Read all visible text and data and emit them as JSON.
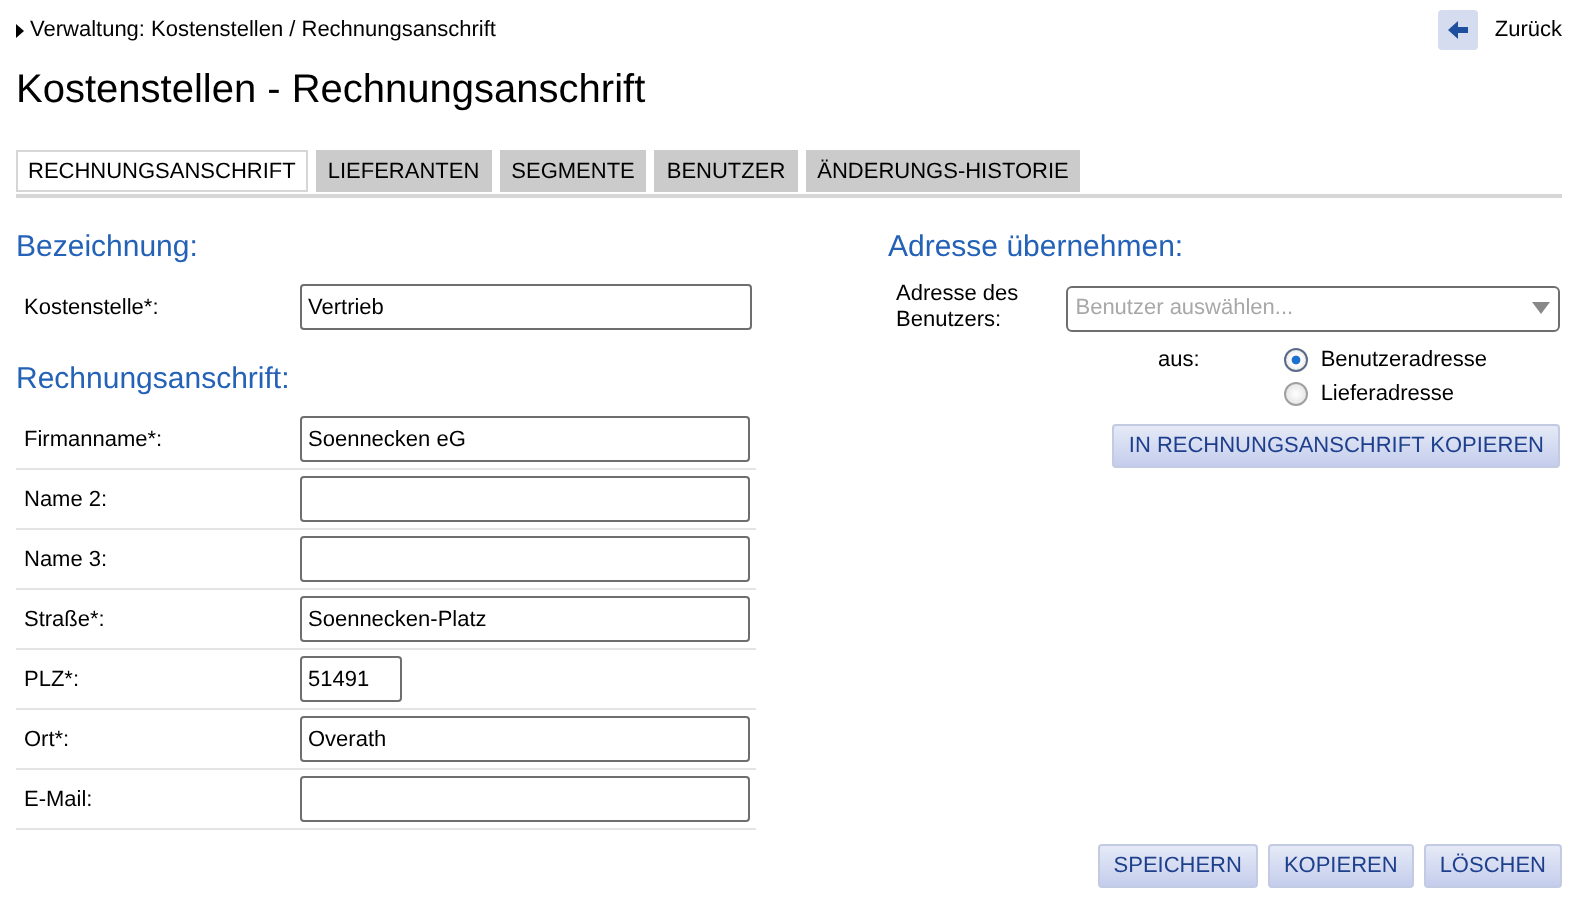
{
  "breadcrumb": "Verwaltung: Kostenstellen / Rechnungsanschrift",
  "back_button": {
    "label": "Zurück"
  },
  "title": "Kostenstellen - Rechnungsanschrift",
  "tabs": [
    {
      "label": "RECHNUNGSANSCHRIFT",
      "selected": true
    },
    {
      "label": "LIEFERANTEN",
      "selected": false
    },
    {
      "label": "SEGMENTE",
      "selected": false
    },
    {
      "label": "BENUTZER",
      "selected": false
    },
    {
      "label": "ÄNDERUNGS-HISTORIE",
      "selected": false
    }
  ],
  "sections": [
    {
      "heading": "Bezeichnung:",
      "fields": [
        {
          "label": "Kostenstelle*:",
          "value": "Vertrieb",
          "kind": "wide"
        }
      ]
    },
    {
      "heading": "Rechnungsanschrift:",
      "fields": [
        {
          "label": "Firmanname*:",
          "value": "Soennecken eG",
          "kind": "text"
        },
        {
          "label": "Name 2:",
          "kind": "text"
        },
        {
          "label": "Name 3:",
          "kind": "text"
        },
        {
          "label": "Straße*:",
          "value": "Soennecken-Platz",
          "kind": "text"
        },
        {
          "label": "PLZ*:",
          "value": "51491",
          "kind": "short"
        },
        {
          "label": "Ort*:",
          "value": "Overath",
          "kind": "text"
        },
        {
          "label": "E-Mail:",
          "kind": "text"
        }
      ]
    }
  ],
  "address_import": {
    "heading": "Adresse übernehmen:",
    "user_label": "Adresse des Benutzers:",
    "user_select": {
      "placeholder": "Benutzer auswählen..."
    },
    "source_label": "aus:",
    "sources": [
      {
        "label": "Benutzeradresse",
        "selected": true
      },
      {
        "label": "Lieferadresse",
        "selected": false
      }
    ],
    "copy_button": "IN RECHNUNGSANSCHRIFT KOPIEREN"
  },
  "actions": [
    "SPEICHERN",
    "KOPIEREN",
    "LÖSCHEN"
  ]
}
